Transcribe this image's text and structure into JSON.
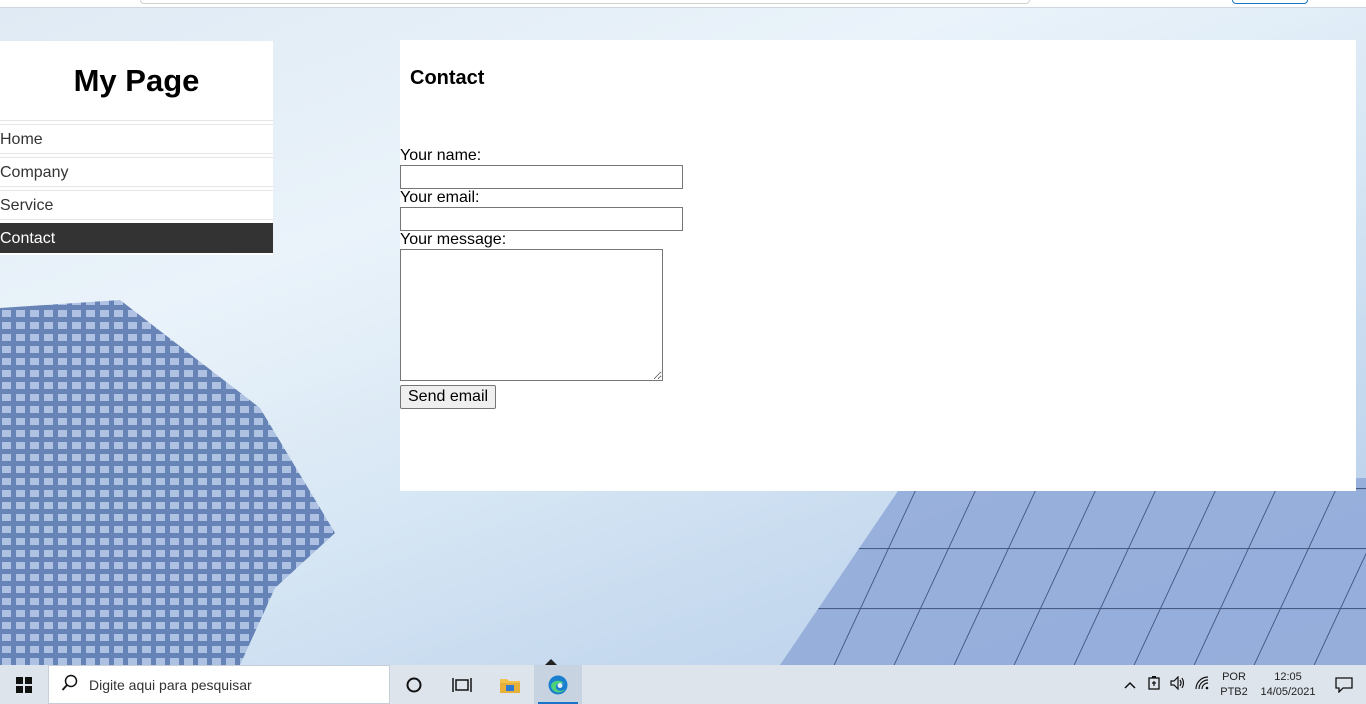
{
  "sidebar": {
    "title": "My Page",
    "items": [
      {
        "label": "Home"
      },
      {
        "label": "Company"
      },
      {
        "label": "Service"
      },
      {
        "label": "Contact"
      }
    ],
    "active_index": 3
  },
  "main": {
    "heading": "Contact",
    "form": {
      "name_label": "Your name:",
      "name_value": "",
      "email_label": "Your email:",
      "email_value": "",
      "message_label": "Your message:",
      "message_value": "",
      "submit_label": "Send email"
    }
  },
  "taskbar": {
    "search_placeholder": "Digite aqui para pesquisar",
    "icons": [
      "windows-start-icon",
      "search-icon",
      "cortana-icon",
      "task-view-icon",
      "file-explorer-icon",
      "edge-browser-icon"
    ],
    "tray": {
      "lang_line1": "POR",
      "lang_line2": "PTB2",
      "time": "12:05",
      "date": "14/05/2021"
    }
  },
  "colors": {
    "active_nav_bg": "#333333",
    "active_nav_text": "#ffffff",
    "taskbar_bg": "#dde4ec",
    "accent": "#1a73c8"
  }
}
